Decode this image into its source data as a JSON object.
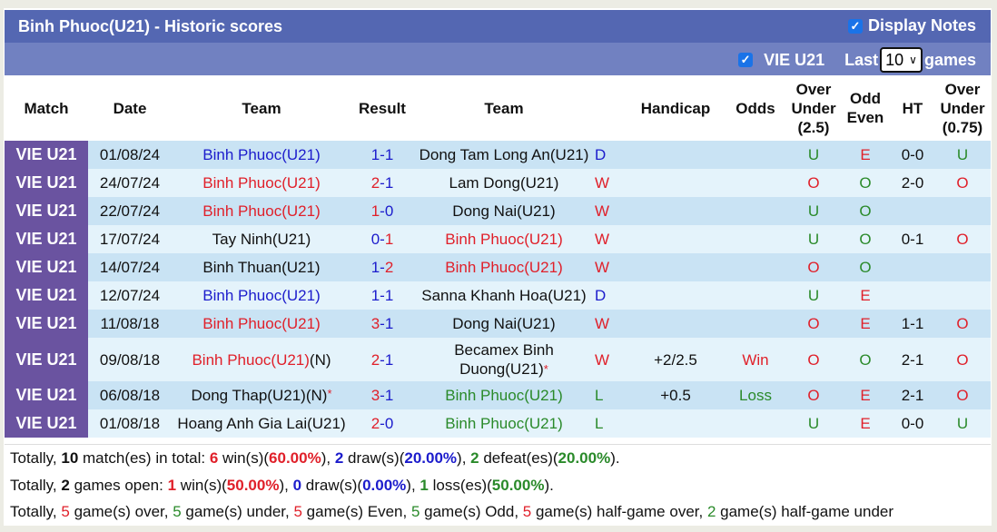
{
  "title": "Binh Phuoc(U21) - Historic scores",
  "display_notes": {
    "label": "Display Notes",
    "checked": true
  },
  "filter": {
    "league_label": "VIE U21",
    "league_checked": true,
    "last_label": "Last",
    "last_value": "10",
    "games_label": "games"
  },
  "headers": {
    "match": "Match",
    "date": "Date",
    "team1": "Team",
    "result": "Result",
    "team2": "Team",
    "handicap": "Handicap",
    "odds": "Odds",
    "ou25_1": "Over",
    "ou25_2": "Under",
    "ou25_3": "(2.5)",
    "oe_1": "Odd",
    "oe_2": "Even",
    "ht": "HT",
    "ou075_1": "Over",
    "ou075_2": "Under",
    "ou075_3": "(0.75)"
  },
  "rows": [
    {
      "match": "VIE U21",
      "date": "01/08/24",
      "home": "Binh Phuoc(U21)",
      "home_suffix": "",
      "home_star": "",
      "hs": "1",
      "as": "1",
      "away": "Dong Tam Long An(U21)",
      "away_star": "",
      "wl": "D",
      "handicap": "",
      "odds": "",
      "ou": "U",
      "oe": "E",
      "ht": "0-0",
      "ou2": "U"
    },
    {
      "match": "VIE U21",
      "date": "24/07/24",
      "home": "Binh Phuoc(U21)",
      "home_suffix": "",
      "home_star": "",
      "hs": "2",
      "as": "1",
      "away": "Lam Dong(U21)",
      "away_star": "",
      "wl": "W",
      "handicap": "",
      "odds": "",
      "ou": "O",
      "oe": "O",
      "ht": "2-0",
      "ou2": "O"
    },
    {
      "match": "VIE U21",
      "date": "22/07/24",
      "home": "Binh Phuoc(U21)",
      "home_suffix": "",
      "home_star": "",
      "hs": "1",
      "as": "0",
      "away": "Dong Nai(U21)",
      "away_star": "",
      "wl": "W",
      "handicap": "",
      "odds": "",
      "ou": "U",
      "oe": "O",
      "ht": "",
      "ou2": ""
    },
    {
      "match": "VIE U21",
      "date": "17/07/24",
      "home": "Tay Ninh(U21)",
      "home_suffix": "",
      "home_star": "",
      "hs": "0",
      "as": "1",
      "away": "Binh Phuoc(U21)",
      "away_star": "",
      "wl": "W",
      "handicap": "",
      "odds": "",
      "ou": "U",
      "oe": "O",
      "ht": "0-1",
      "ou2": "O"
    },
    {
      "match": "VIE U21",
      "date": "14/07/24",
      "home": "Binh Thuan(U21)",
      "home_suffix": "",
      "home_star": "",
      "hs": "1",
      "as": "2",
      "away": "Binh Phuoc(U21)",
      "away_star": "",
      "wl": "W",
      "handicap": "",
      "odds": "",
      "ou": "O",
      "oe": "O",
      "ht": "",
      "ou2": ""
    },
    {
      "match": "VIE U21",
      "date": "12/07/24",
      "home": "Binh Phuoc(U21)",
      "home_suffix": "",
      "home_star": "",
      "hs": "1",
      "as": "1",
      "away": "Sanna Khanh Hoa(U21)",
      "away_star": "",
      "wl": "D",
      "handicap": "",
      "odds": "",
      "ou": "U",
      "oe": "E",
      "ht": "",
      "ou2": ""
    },
    {
      "match": "VIE U21",
      "date": "11/08/18",
      "home": "Binh Phuoc(U21)",
      "home_suffix": "",
      "home_star": "",
      "hs": "3",
      "as": "1",
      "away": "Dong Nai(U21)",
      "away_star": "",
      "wl": "W",
      "handicap": "",
      "odds": "",
      "ou": "O",
      "oe": "E",
      "ht": "1-1",
      "ou2": "O"
    },
    {
      "match": "VIE U21",
      "date": "09/08/18",
      "home": "Binh Phuoc(U21)",
      "home_suffix": "(N)",
      "home_star": "",
      "hs": "2",
      "as": "1",
      "away": "Becamex Binh Duong(U21)",
      "away_star": "*",
      "wl": "W",
      "handicap": "+2/2.5",
      "odds": "Win",
      "ou": "O",
      "oe": "O",
      "ht": "2-1",
      "ou2": "O"
    },
    {
      "match": "VIE U21",
      "date": "06/08/18",
      "home": "Dong Thap(U21)",
      "home_suffix": "(N)",
      "home_star": "*",
      "hs": "3",
      "as": "1",
      "away": "Binh Phuoc(U21)",
      "away_star": "",
      "wl": "L",
      "handicap": "+0.5",
      "odds": "Loss",
      "ou": "O",
      "oe": "E",
      "ht": "2-1",
      "ou2": "O"
    },
    {
      "match": "VIE U21",
      "date": "01/08/18",
      "home": "Hoang Anh Gia Lai(U21)",
      "home_suffix": "",
      "home_star": "",
      "hs": "2",
      "as": "0",
      "away": "Binh Phuoc(U21)",
      "away_star": "",
      "wl": "L",
      "handicap": "",
      "odds": "",
      "ou": "U",
      "oe": "E",
      "ht": "0-0",
      "ou2": "U"
    }
  ],
  "summary": {
    "line1": {
      "t1": "Totally, ",
      "n_total": "10",
      "t2": " match(es) in total: ",
      "wins": "6",
      "t3": " win(s)(",
      "win_pct": "60.00%",
      "t4": "), ",
      "draws": "2",
      "t5": " draw(s)(",
      "draw_pct": "20.00%",
      "t6": "), ",
      "defeats": "2",
      "t7": " defeat(es)(",
      "defeat_pct": "20.00%",
      "t8": ")."
    },
    "line2": {
      "t1": "Totally, ",
      "open": "2",
      "t2": " games open: ",
      "wins": "1",
      "t3": " win(s)(",
      "win_pct": "50.00%",
      "t4": "), ",
      "draws": "0",
      "t5": " draw(s)(",
      "draw_pct": "0.00%",
      "t6": "), ",
      "losses": "1",
      "t7": " loss(es)(",
      "loss_pct": "50.00%",
      "t8": ")."
    },
    "line3": {
      "t1": "Totally, ",
      "over": "5",
      "t2": " game(s) over, ",
      "under": "5",
      "t3": " game(s) under, ",
      "even": "5",
      "t4": " game(s) Even, ",
      "odd": "5",
      "t5": " game(s) Odd, ",
      "hg_over": "5",
      "t6": " game(s) half-game over, ",
      "hg_under": "2",
      "t7": " game(s) half-game under"
    }
  },
  "colors": {
    "title_bar": "#5467b2",
    "sub_bar": "#7181c1",
    "match_cell": "#6a53a0",
    "row_a": "#c9e3f4",
    "row_b": "#e4f3fb",
    "win": "#e0202a",
    "draw": "#1c1ccc",
    "loss": "#2a8a2a"
  }
}
